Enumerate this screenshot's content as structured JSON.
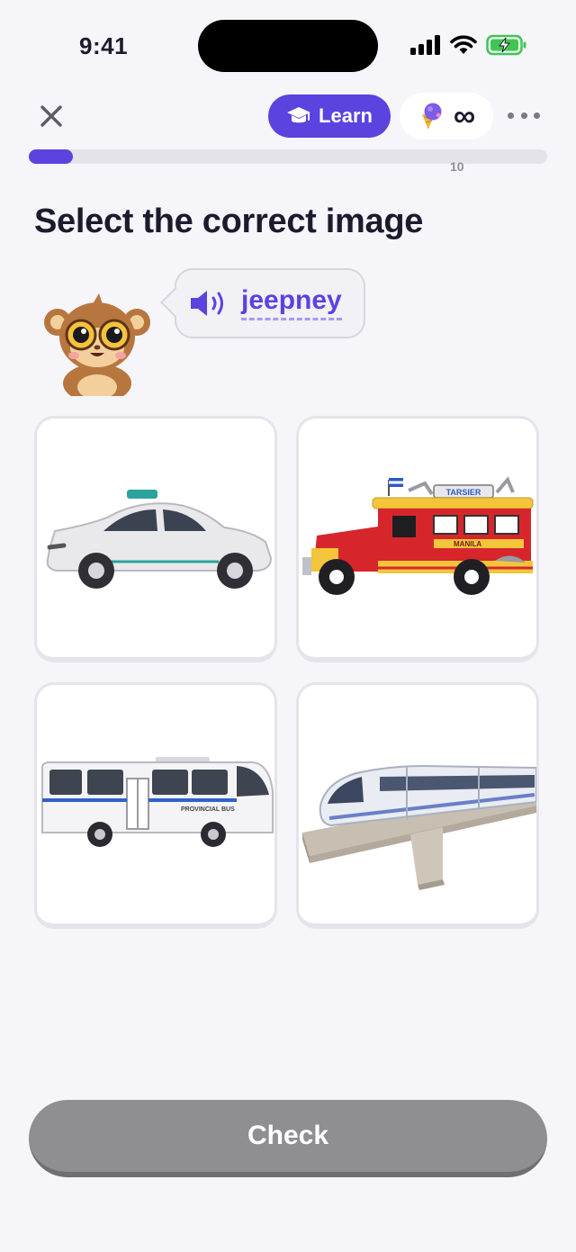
{
  "status_bar": {
    "time": "9:41"
  },
  "header": {
    "learn_label": "Learn",
    "hearts_value": "∞",
    "progress": {
      "current_fraction": 0.085,
      "total_label": "10"
    }
  },
  "prompt": {
    "title": "Select the correct image",
    "word": "jeepney"
  },
  "options": [
    {
      "id": "taxi",
      "label": ""
    },
    {
      "id": "jeepney",
      "label": "",
      "roof_text": "TARSIER",
      "side_text": "MANILA"
    },
    {
      "id": "bus",
      "label": "",
      "side_text": "PROVINCIAL BUS"
    },
    {
      "id": "train",
      "label": ""
    }
  ],
  "footer": {
    "check_label": "Check"
  },
  "colors": {
    "accent": "#5b43e0",
    "disabled_button": "#8e8e93",
    "background": "#f5f5fa"
  }
}
